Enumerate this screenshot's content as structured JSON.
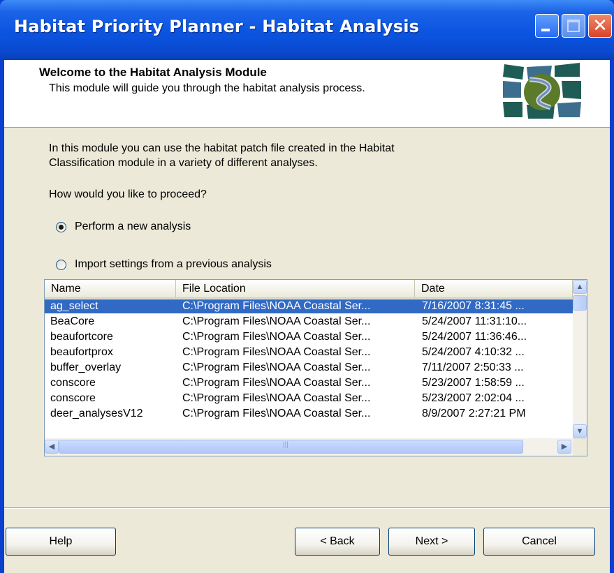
{
  "window": {
    "title": "Habitat Priority Planner - Habitat Analysis",
    "close_glyph": "✕"
  },
  "header": {
    "title": "Welcome to the Habitat Analysis Module",
    "subtitle": "This module will guide you through the habitat analysis process.",
    "logo_icon": "habitat-logo-icon",
    "logo_colors": [
      "#1f5c55",
      "#5b7a2a",
      "#3d6e8e",
      "#c8d2da"
    ]
  },
  "intro": {
    "line1": "In this module you can use the habitat patch file created in the Habitat",
    "line2": "Classification module in a variety of different analyses.",
    "question": "How would you like to proceed?"
  },
  "options": {
    "new_label": "Perform a new analysis",
    "import_label": "Import settings from a previous analysis",
    "selected": "new"
  },
  "list": {
    "columns": [
      "Name",
      "File Location",
      "Date"
    ],
    "rows": [
      {
        "name": "ag_select",
        "location": "C:\\Program Files\\NOAA Coastal Ser...",
        "date": "7/16/2007 8:31:45 ...",
        "selected": true
      },
      {
        "name": "BeaCore",
        "location": "C:\\Program Files\\NOAA Coastal Ser...",
        "date": "5/24/2007 11:31:10..."
      },
      {
        "name": "beaufortcore",
        "location": "C:\\Program Files\\NOAA Coastal Ser...",
        "date": "5/24/2007 11:36:46..."
      },
      {
        "name": "beaufortprox",
        "location": "C:\\Program Files\\NOAA Coastal Ser...",
        "date": "5/24/2007 4:10:32 ..."
      },
      {
        "name": "buffer_overlay",
        "location": "C:\\Program Files\\NOAA Coastal Ser...",
        "date": "7/11/2007 2:50:33 ..."
      },
      {
        "name": "conscore",
        "location": "C:\\Program Files\\NOAA Coastal Ser...",
        "date": "5/23/2007 1:58:59 ..."
      },
      {
        "name": "conscore",
        "location": "C:\\Program Files\\NOAA Coastal Ser...",
        "date": "5/23/2007 2:02:04 ..."
      },
      {
        "name": "deer_analysesV12",
        "location": "C:\\Program Files\\NOAA Coastal Ser...",
        "date": "8/9/2007 2:27:21 PM"
      }
    ],
    "scroll_up_glyph": "▲",
    "scroll_down_glyph": "▼",
    "scroll_left_glyph": "◀",
    "scroll_right_glyph": "▶",
    "hthumb_grip": "|||"
  },
  "buttons": {
    "help": "Help",
    "back": "< Back",
    "next": "Next >",
    "cancel": "Cancel"
  },
  "colors": {
    "titlebar": "#0a54e0",
    "selection": "#316ac5",
    "dialog_bg": "#ece9d8"
  }
}
